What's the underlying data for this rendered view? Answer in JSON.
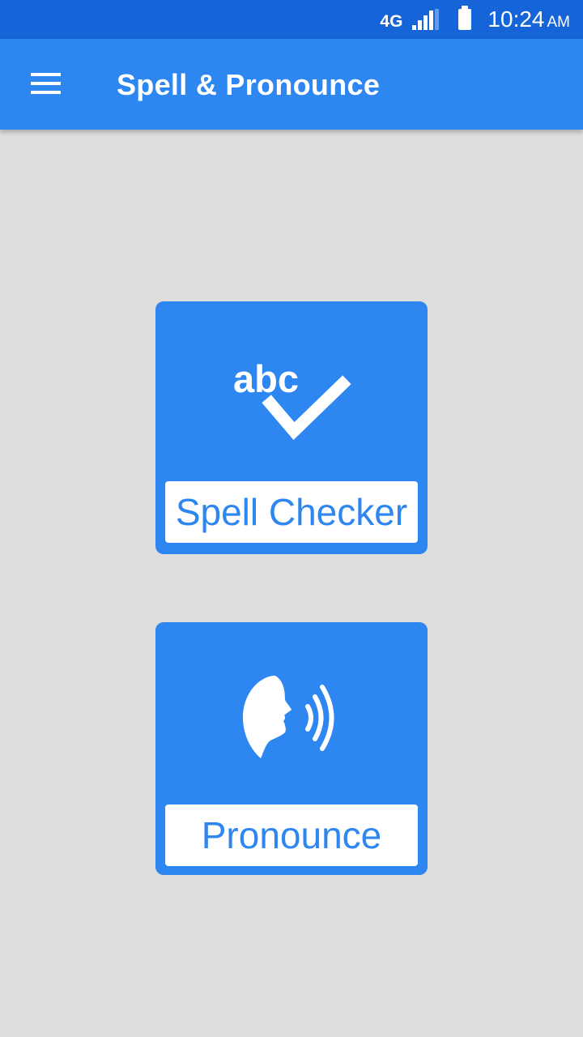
{
  "status_bar": {
    "network": "4G",
    "time": "10:24",
    "ampm": "AM"
  },
  "app_bar": {
    "title": "Spell & Pronounce"
  },
  "cards": {
    "spell_checker": {
      "label": "Spell Checker",
      "icon_text": "abc",
      "icon": "abc-check-icon"
    },
    "pronounce": {
      "label": "Pronounce",
      "icon": "speaking-head-icon"
    }
  },
  "colors": {
    "status_bar": "#1565d8",
    "primary": "#2e86f1",
    "background": "#dedede",
    "label_bg": "#ffffff"
  }
}
